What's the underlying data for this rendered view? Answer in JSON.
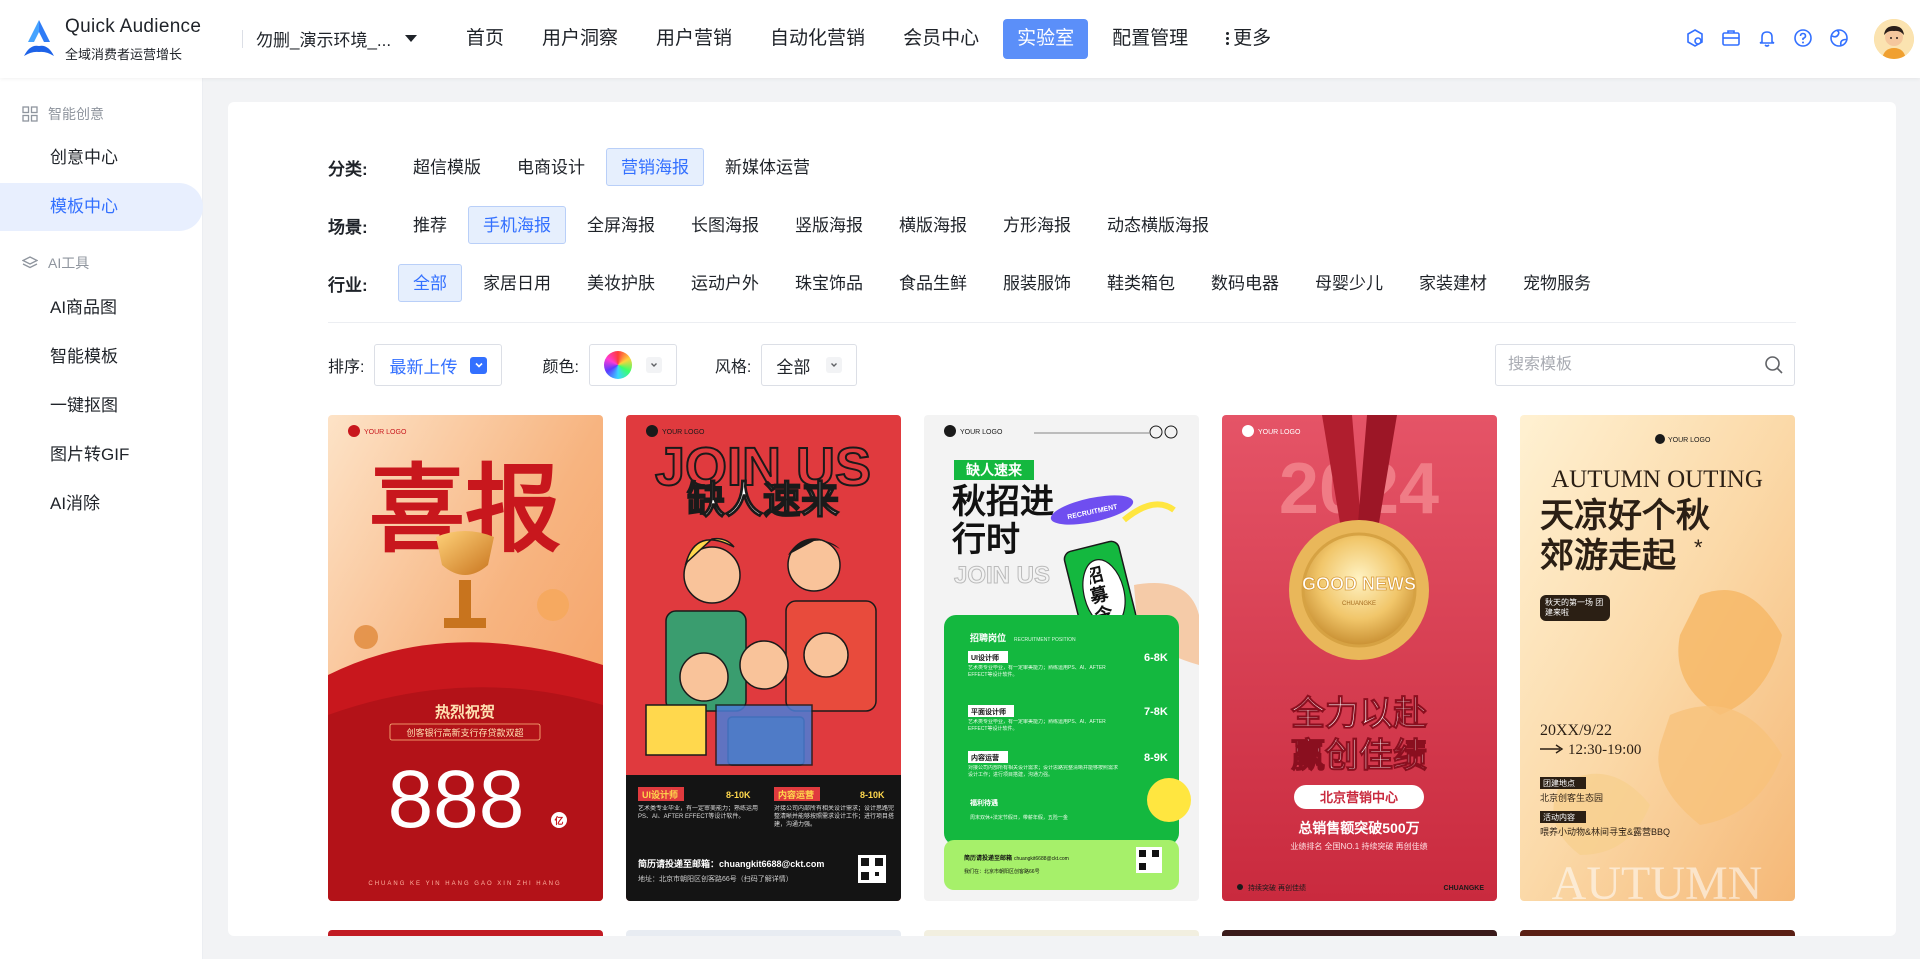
{
  "brand": {
    "name": "Quick Audience",
    "subtitle": "全域消费者运营增长"
  },
  "env": {
    "label": "勿删_演示环境_..."
  },
  "nav": {
    "items": [
      "首页",
      "用户洞察",
      "用户营销",
      "自动化营销",
      "会员中心",
      "实验室",
      "配置管理"
    ],
    "active_index": 5,
    "more_label": "更多"
  },
  "top_icons": [
    "app-icon",
    "briefcase-icon",
    "bell-icon",
    "help-icon",
    "globe-icon"
  ],
  "sidebar": {
    "groups": [
      {
        "title": "智能创意",
        "icon": "grid-icon",
        "items": [
          "创意中心",
          "模板中心"
        ]
      },
      {
        "title": "AI工具",
        "icon": "layers-icon",
        "items": [
          "AI商品图",
          "智能模板",
          "一键抠图",
          "图片转GIF",
          "AI消除"
        ]
      }
    ],
    "active_item": "模板中心"
  },
  "filters": {
    "category": {
      "label": "分类:",
      "options": [
        "超信模版",
        "电商设计",
        "营销海报",
        "新媒体运营"
      ],
      "active": "营销海报"
    },
    "scene": {
      "label": "场景:",
      "options": [
        "推荐",
        "手机海报",
        "全屏海报",
        "长图海报",
        "竖版海报",
        "横版海报",
        "方形海报",
        "动态横版海报"
      ],
      "active": "手机海报"
    },
    "industry": {
      "label": "行业:",
      "options": [
        "全部",
        "家居日用",
        "美妆护肤",
        "运动户外",
        "珠宝饰品",
        "食品生鲜",
        "服装服饰",
        "鞋类箱包",
        "数码电器",
        "母婴少儿",
        "家装建材",
        "宠物服务"
      ],
      "active": "全部"
    }
  },
  "sort": {
    "label": "排序:",
    "value": "最新上传"
  },
  "color": {
    "label": "颜色:"
  },
  "style": {
    "label": "风格:",
    "value": "全部"
  },
  "search": {
    "placeholder": "搜索模板"
  },
  "templates": [
    {
      "logo": "YOUR LOGO",
      "headline": "喜报",
      "ribbon": "热烈祝贺",
      "subline": "创客银行高新支行存贷款双超",
      "number": "888",
      "unit": "亿",
      "footer": "CHUANG KE YIN HANG GAO XIN ZHI HANG",
      "colors": {
        "bg": "#f7b480",
        "accent": "#c8171d"
      }
    },
    {
      "logo": "YOUR LOGO",
      "headline_en": "JOIN US",
      "headline": "缺人速来",
      "job1": "UI设计师",
      "salary1": "8-10K",
      "job2": "内容运营",
      "salary2": "8-10K",
      "job1_desc": "艺术类专业毕业，有一定审美能力；熟练运用PS、AI、AFTER EFFECT等设计软件。",
      "job2_desc": "对接公司内部所有相关设计需求；设计思路完整清晰并能够按照需求设计工作；进行项目搭建，沟通力强。",
      "contact": "简历请投递至邮箱：chuangkit6688@ckt.com",
      "address": "地址：北京市朝阳区创客路66号（扫码了解详情）",
      "colors": {
        "bg": "#e03a3e",
        "accent": "#ffd84d"
      }
    },
    {
      "logo": "YOUR LOGO",
      "tag": "缺人速来",
      "headline": "秋招进行时",
      "badge": "RECRUITMENT",
      "stamp": "招募令",
      "bg_text": "JOIN US",
      "section": "招聘岗位",
      "section_en": "RECRUITMENT POSITION",
      "jobs": [
        {
          "name": "UI设计师",
          "salary": "6-8K"
        },
        {
          "name": "平面设计师",
          "salary": "7-8K"
        },
        {
          "name": "内容运营",
          "salary": "8-9K"
        }
      ],
      "job_desc": "艺术类专业毕业，有一定审美能力；熟练运用PS、AI、AFTER EFFECT等设计软件。",
      "job3_desc": "对接公司内部所有相关设计需求；设计思路完整清晰并能够按照需求设计工作；进行项目搭建，沟通力强。",
      "benefit": "福利待遇",
      "benefit_desc": "周末双休+法定节假日，带薪年假，五险一金",
      "contact_label": "简历请投递至邮箱",
      "contact_email": "chuangkit6688@ckt.com",
      "address": "我们在：北京市朝阳区创客路66号",
      "colors": {
        "bg": "#f3f3f3",
        "accent": "#14b83f"
      }
    },
    {
      "logo": "YOUR LOGO",
      "year": "2024",
      "medal": "GOOD NEWS",
      "medal_sub": "CHUANGKE",
      "headline1": "全力以赴",
      "headline2": "赢创佳绩",
      "center": "北京营销中心",
      "result": "总销售额突破500万",
      "subline": "业绩排名 全国NO.1 持续突破 再创佳绩",
      "footer_left": "持续突破 再创佳绩",
      "footer_right": "CHUANGKE",
      "colors": {
        "bg": "#d9364a",
        "accent": "#e8b85c"
      }
    },
    {
      "logo": "YOUR LOGO",
      "title_en": "AUTUMN OUTING",
      "headline1": "天凉好个秋",
      "headline2": "郊游走起",
      "star": "*",
      "pill": "秋天的第一场 团建来啦",
      "date": "20XX/9/22",
      "time": "12:30-19:00",
      "place_label": "团建地点",
      "place": "北京创客生态园",
      "content_label": "活动内容",
      "content": "喂养小动物&林间寻宝&露营BBQ",
      "footer_en": "AUTUMN",
      "colors": {
        "bg": "#fbd9a8",
        "accent": "#f39a3a"
      }
    }
  ]
}
